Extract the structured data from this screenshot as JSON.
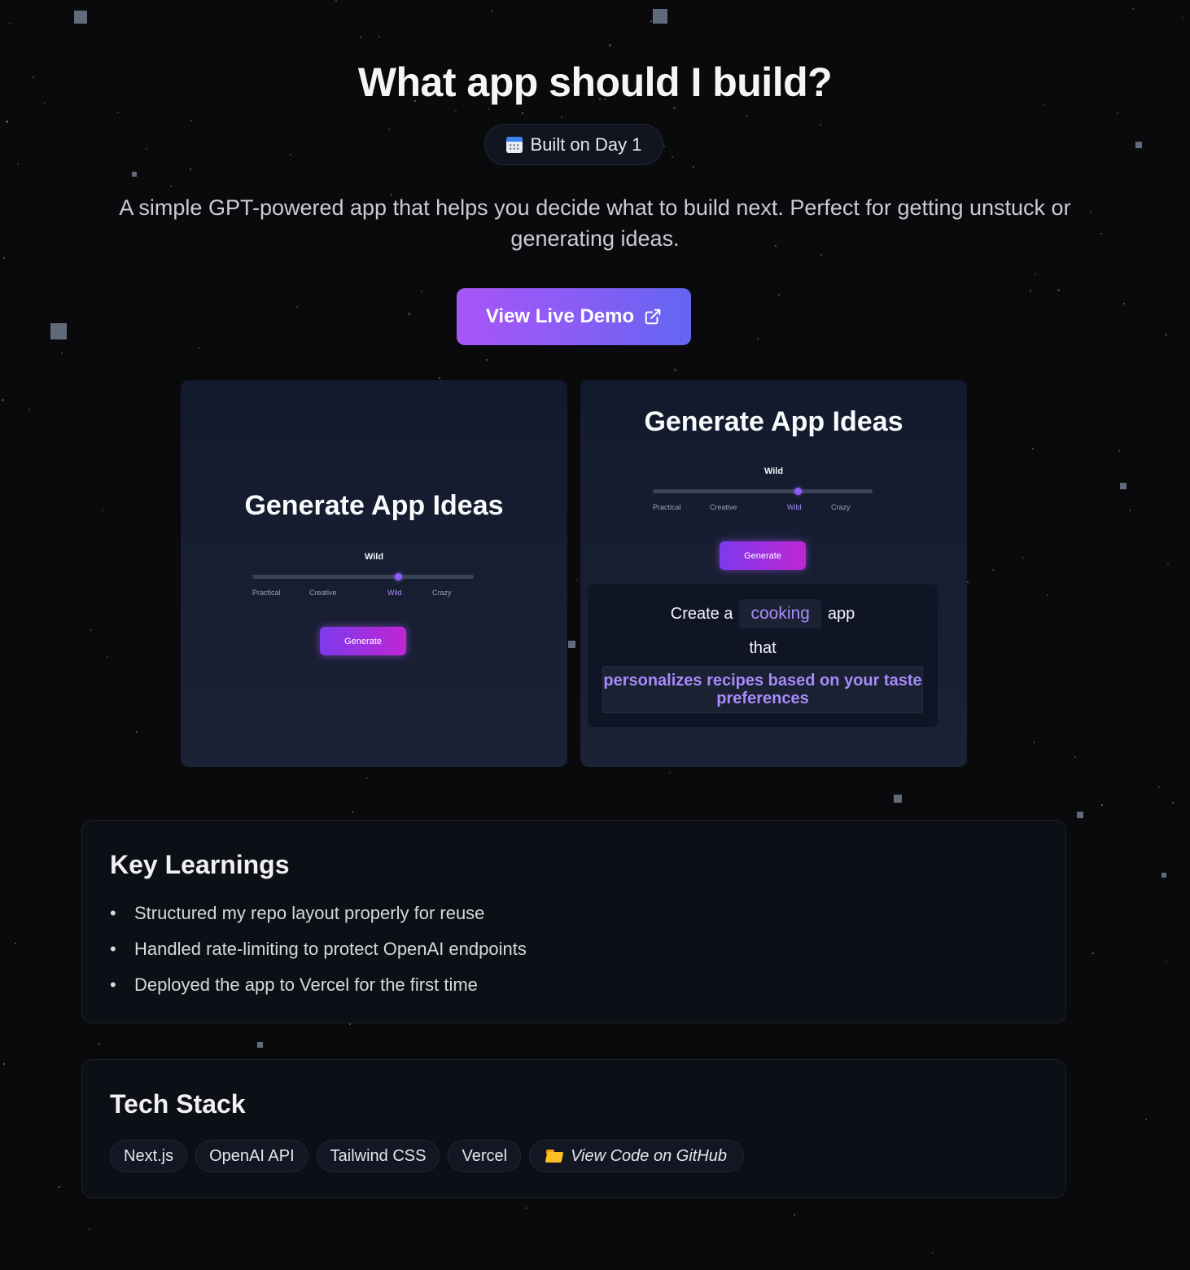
{
  "page": {
    "title": "What app should I build?",
    "badge": "Built on Day 1",
    "description": "A simple GPT-powered app that helps you decide what to build next. Perfect for getting unstuck or generating ideas.",
    "demo_button": "View Live Demo",
    "demo_icon": "external-link-icon",
    "badge_icon": "calendar-icon"
  },
  "screenshots": {
    "left": {
      "title": "Generate App Ideas",
      "slider_label": "Wild",
      "ticks": [
        "Practical",
        "Creative",
        "Wild",
        "Crazy"
      ],
      "active_tick": "Wild",
      "generate_label": "Generate"
    },
    "right": {
      "title": "Generate App Ideas",
      "slider_label": "Wild",
      "ticks": [
        "Practical",
        "Creative",
        "Wild",
        "Crazy"
      ],
      "active_tick": "Wild",
      "generate_label": "Generate",
      "result": {
        "prefix": "Create a",
        "category": "cooking",
        "suffix": "app",
        "connector": "that",
        "feature": "personalizes recipes based on your taste preferences"
      }
    }
  },
  "learnings": {
    "title": "Key Learnings",
    "items": [
      "Structured my repo layout properly for reuse",
      "Handled rate-limiting to protect OpenAI endpoints",
      "Deployed the app to Vercel for the first time"
    ]
  },
  "tech": {
    "title": "Tech Stack",
    "chips": [
      "Next.js",
      "OpenAI API",
      "Tailwind CSS",
      "Vercel"
    ],
    "github_label": "View Code on GitHub",
    "github_icon": "folder-icon"
  },
  "colors": {
    "background": "#0a0a0c",
    "accent_purple": "#a855f7",
    "accent_indigo": "#6366f1",
    "highlight_text": "#a78bfa"
  }
}
